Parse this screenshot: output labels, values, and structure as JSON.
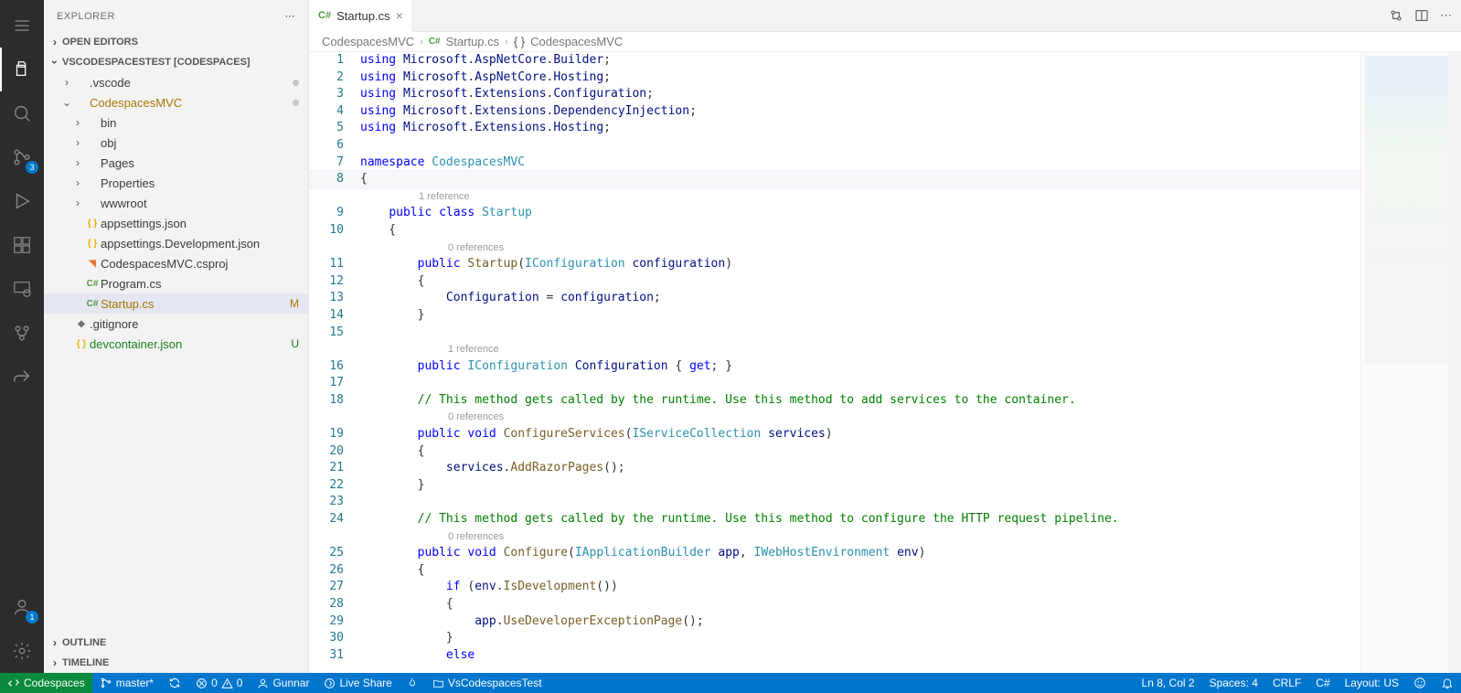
{
  "sidebar": {
    "title": "EXPLORER",
    "sections": {
      "openEditors": "OPEN EDITORS",
      "folder": "VSCODESPACESTEST [CODESPACES]",
      "outline": "OUTLINE",
      "timeline": "TIMELINE"
    },
    "tree": [
      {
        "type": "folder",
        "label": ".vscode",
        "depth": 1,
        "decor": "dot"
      },
      {
        "type": "folder",
        "label": "CodespacesMVC",
        "depth": 1,
        "expanded": true,
        "decor": "dot",
        "labelClass": "mod"
      },
      {
        "type": "folder",
        "label": "bin",
        "depth": 2
      },
      {
        "type": "folder",
        "label": "obj",
        "depth": 2
      },
      {
        "type": "folder",
        "label": "Pages",
        "depth": 2
      },
      {
        "type": "folder",
        "label": "Properties",
        "depth": 2
      },
      {
        "type": "folder",
        "label": "wwwroot",
        "depth": 2
      },
      {
        "type": "file",
        "label": "appsettings.json",
        "depth": 2,
        "icon": "braces",
        "iconColor": "#f0ad00"
      },
      {
        "type": "file",
        "label": "appsettings.Development.json",
        "depth": 2,
        "icon": "braces",
        "iconColor": "#f0ad00"
      },
      {
        "type": "file",
        "label": "CodespacesMVC.csproj",
        "depth": 2,
        "icon": "rss",
        "iconColor": "#e37933"
      },
      {
        "type": "file",
        "label": "Program.cs",
        "depth": 2,
        "icon": "cs",
        "iconColor": "#529742"
      },
      {
        "type": "file",
        "label": "Startup.cs",
        "depth": 2,
        "icon": "cs",
        "iconColor": "#529742",
        "selected": true,
        "decor": "M",
        "labelClass": "mod"
      },
      {
        "type": "file",
        "label": ".gitignore",
        "depth": 1,
        "icon": "git",
        "iconColor": "#757575"
      },
      {
        "type": "file",
        "label": "devcontainer.json",
        "depth": 1,
        "icon": "braces",
        "iconColor": "#f0ad00",
        "decor": "U",
        "labelClass": "unt"
      }
    ]
  },
  "activity": {
    "scmBadge": "3",
    "accountBadge": "1"
  },
  "tabs": {
    "active": "Startup.cs"
  },
  "breadcrumbs": {
    "seg1": "CodespacesMVC",
    "seg2": "Startup.cs",
    "seg3": "CodespacesMVC"
  },
  "code": [
    {
      "n": 1,
      "html": "<span class='kw'>using</span> <span class='id'>Microsoft</span>.<span class='id'>AspNetCore</span>.<span class='id'>Builder</span>;"
    },
    {
      "n": 2,
      "html": "<span class='kw'>using</span> <span class='id'>Microsoft</span>.<span class='id'>AspNetCore</span>.<span class='id'>Hosting</span>;"
    },
    {
      "n": 3,
      "html": "<span class='kw'>using</span> <span class='id'>Microsoft</span>.<span class='id'>Extensions</span>.<span class='id'>Configuration</span>;"
    },
    {
      "n": 4,
      "html": "<span class='kw'>using</span> <span class='id'>Microsoft</span>.<span class='id'>Extensions</span>.<span class='id'>DependencyInjection</span>;"
    },
    {
      "n": 5,
      "html": "<span class='kw'>using</span> <span class='id'>Microsoft</span>.<span class='id'>Extensions</span>.<span class='id'>Hosting</span>;"
    },
    {
      "n": 6,
      "html": ""
    },
    {
      "n": 7,
      "html": "<span class='kw'>namespace</span> <span class='ns'>CodespacesMVC</span>"
    },
    {
      "n": 8,
      "html": "{",
      "current": true
    },
    {
      "codelens": "1 reference",
      "indent": 8
    },
    {
      "n": 9,
      "html": "    <span class='kw'>public</span> <span class='kw'>class</span> <span class='type'>Startup</span>"
    },
    {
      "n": 10,
      "html": "    {"
    },
    {
      "codelens": "0 references",
      "indent": 12
    },
    {
      "n": 11,
      "html": "        <span class='kw'>public</span> <span class='fn'>Startup</span>(<span class='type'>IConfiguration</span> <span class='id'>configuration</span>)"
    },
    {
      "n": 12,
      "html": "        {"
    },
    {
      "n": 13,
      "html": "            <span class='id'>Configuration</span> = <span class='id'>configuration</span>;"
    },
    {
      "n": 14,
      "html": "        }"
    },
    {
      "n": 15,
      "html": ""
    },
    {
      "codelens": "1 reference",
      "indent": 12
    },
    {
      "n": 16,
      "html": "        <span class='kw'>public</span> <span class='type'>IConfiguration</span> <span class='id'>Configuration</span> { <span class='kw'>get</span>; }"
    },
    {
      "n": 17,
      "html": ""
    },
    {
      "n": 18,
      "html": "        <span class='cm'>// This method gets called by the runtime. Use this method to add services to the container.</span>"
    },
    {
      "codelens": "0 references",
      "indent": 12
    },
    {
      "n": 19,
      "html": "        <span class='kw'>public</span> <span class='kw'>void</span> <span class='fn'>ConfigureServices</span>(<span class='type'>IServiceCollection</span> <span class='id'>services</span>)"
    },
    {
      "n": 20,
      "html": "        {"
    },
    {
      "n": 21,
      "html": "            <span class='id'>services</span>.<span class='fn'>AddRazorPages</span>();"
    },
    {
      "n": 22,
      "html": "        }"
    },
    {
      "n": 23,
      "html": ""
    },
    {
      "n": 24,
      "html": "        <span class='cm'>// This method gets called by the runtime. Use this method to configure the HTTP request pipeline.</span>"
    },
    {
      "codelens": "0 references",
      "indent": 12
    },
    {
      "n": 25,
      "html": "        <span class='kw'>public</span> <span class='kw'>void</span> <span class='fn'>Configure</span>(<span class='type'>IApplicationBuilder</span> <span class='id'>app</span>, <span class='type'>IWebHostEnvironment</span> <span class='id'>env</span>)"
    },
    {
      "n": 26,
      "html": "        {"
    },
    {
      "n": 27,
      "html": "            <span class='kw'>if</span> (<span class='id'>env</span>.<span class='fn'>IsDevelopment</span>())"
    },
    {
      "n": 28,
      "html": "            {"
    },
    {
      "n": 29,
      "html": "                <span class='id'>app</span>.<span class='fn'>UseDeveloperExceptionPage</span>();"
    },
    {
      "n": 30,
      "html": "            }"
    },
    {
      "n": 31,
      "html": "            <span class='kw'>else</span>"
    }
  ],
  "status": {
    "codespaces": "Codespaces",
    "branch": "master*",
    "errors": "0",
    "warnings": "0",
    "user": "Gunnar",
    "liveShare": "Live Share",
    "project": "VsCodespacesTest",
    "lncol": "Ln 8, Col 2",
    "spaces": "Spaces: 4",
    "eol": "CRLF",
    "lang": "C#",
    "layout": "Layout: US"
  }
}
